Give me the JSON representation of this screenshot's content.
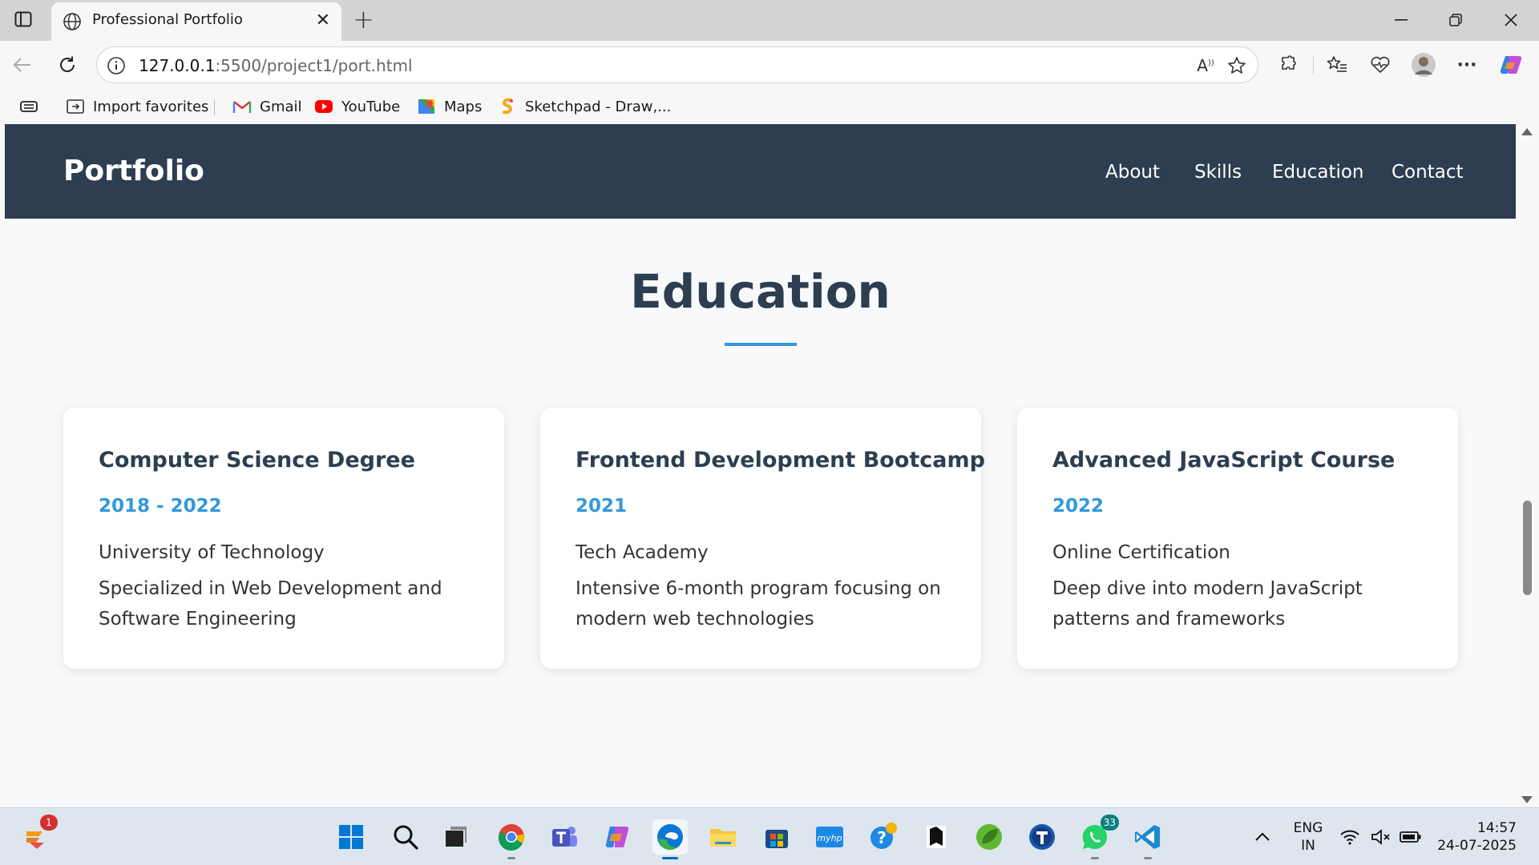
{
  "browser": {
    "tab_title": "Professional Portfolio",
    "url_host": "127.0.0.1",
    "url_rest": ":5500/project1/port.html",
    "favorites": [
      {
        "label": "Import favorites",
        "icon": "import-icon"
      },
      {
        "label": "Gmail",
        "icon": "gmail-icon"
      },
      {
        "label": "YouTube",
        "icon": "youtube-icon"
      },
      {
        "label": "Maps",
        "icon": "maps-icon"
      },
      {
        "label": "Sketchpad - Draw,...",
        "icon": "sketchpad-icon"
      }
    ]
  },
  "site": {
    "brand": "Portfolio",
    "nav": [
      "About",
      "Skills",
      "Education",
      "Contact"
    ],
    "section_title": "Education",
    "accent_color": "#3498db",
    "nav_bg": "#2c3e50",
    "cards": [
      {
        "title": "Computer Science Degree",
        "year": "2018 - 2022",
        "institution": "University of Technology",
        "description": "Specialized in Web Development and Software Engineering"
      },
      {
        "title": "Frontend Development Bootcamp",
        "year": "2021",
        "institution": "Tech Academy",
        "description": "Intensive 6-month program focusing on modern web technologies"
      },
      {
        "title": "Advanced JavaScript Course",
        "year": "2022",
        "institution": "Online Certification",
        "description": "Deep dive into modern JavaScript patterns and frameworks"
      }
    ]
  },
  "taskbar": {
    "notification_badge": "1",
    "whatsapp_badge": "33",
    "language": "ENG",
    "region": "IN",
    "time": "14:57",
    "date": "24-07-2025"
  }
}
